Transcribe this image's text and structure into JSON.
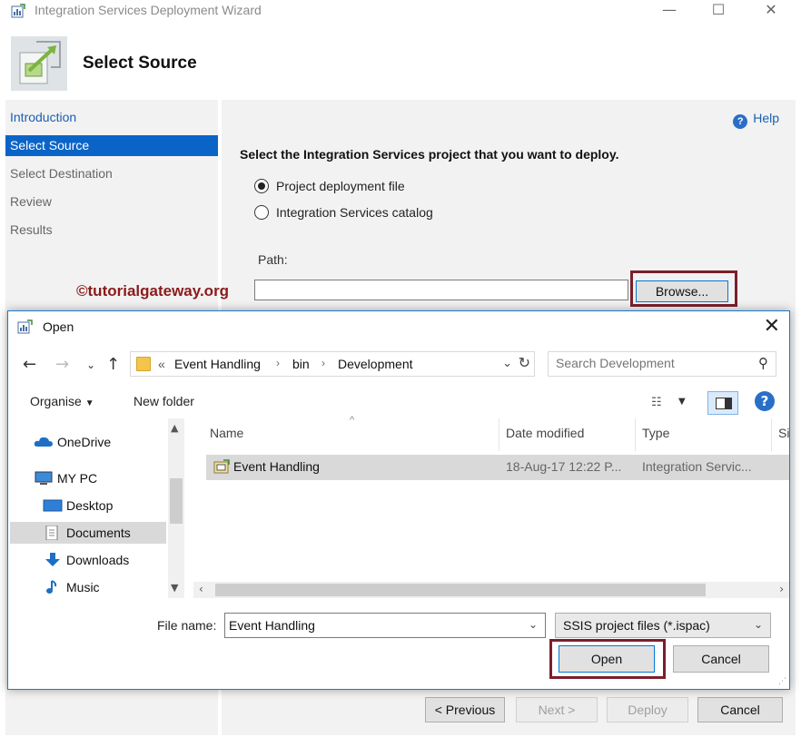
{
  "window": {
    "title": "Integration Services Deployment Wizard",
    "minimize": "—",
    "maximize": "☐",
    "close": "✕"
  },
  "header": {
    "title": "Select Source"
  },
  "nav": {
    "items": [
      {
        "label": "Introduction",
        "state": "link"
      },
      {
        "label": "Select Source",
        "state": "selected"
      },
      {
        "label": "Select Destination",
        "state": "normal"
      },
      {
        "label": "Review",
        "state": "normal"
      },
      {
        "label": "Results",
        "state": "normal"
      }
    ]
  },
  "main": {
    "help_label": "Help",
    "prompt": "Select the Integration Services project that you want to deploy.",
    "radio_file": "Project deployment file",
    "radio_catalog": "Integration Services catalog",
    "path_label": "Path:",
    "path_value": "",
    "browse_label": "Browse..."
  },
  "watermark": "©tutorialgateway.org",
  "footer": {
    "previous": "< Previous",
    "next": "Next >",
    "deploy": "Deploy",
    "cancel": "Cancel"
  },
  "dialog": {
    "title": "Open",
    "address": {
      "overflow": "«",
      "crumbs": [
        "Event Handling",
        "bin",
        "Development"
      ]
    },
    "search_placeholder": "Search Development",
    "organise": "Organise",
    "new_folder": "New folder",
    "tree": [
      "OneDrive",
      "MY PC",
      "Desktop",
      "Documents",
      "Downloads",
      "Music"
    ],
    "columns": [
      "Name",
      "Date modified",
      "Type",
      "Si"
    ],
    "files": [
      {
        "name": "Event Handling",
        "date": "18-Aug-17 12:22 P...",
        "type": "Integration Servic..."
      }
    ],
    "file_name_label": "File name:",
    "file_name_value": "Event Handling",
    "file_type": "SSIS project files (*.ispac)",
    "open_label": "Open",
    "cancel_label": "Cancel"
  },
  "colors": {
    "accent": "#0a64c8",
    "link": "#1a5fb4",
    "highlight_box": "#7a1f2c",
    "watermark": "#8b1b1b",
    "folder": "#f4c54d"
  }
}
